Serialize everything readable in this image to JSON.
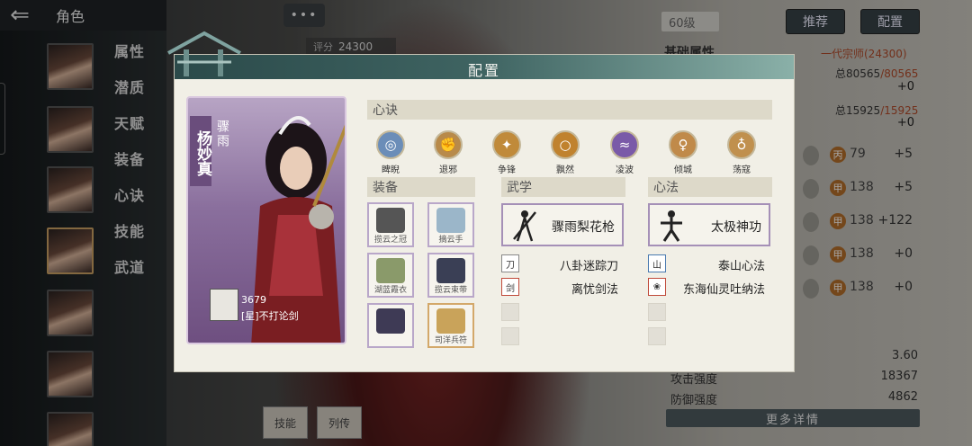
{
  "header": {
    "back_icon": "back-arrow-icon",
    "title": "角色"
  },
  "sidebar": {
    "menu": [
      "属性",
      "潜质",
      "天赋",
      "装备",
      "心诀",
      "技能",
      "武道"
    ]
  },
  "top": {
    "chat": "•••",
    "level": "60级",
    "recommend": "推荐",
    "config": "配置",
    "score_label": "评分",
    "score_value": "24300"
  },
  "right_stats": {
    "basic_title": "基础属性",
    "rank": "一代宗师(24300)",
    "hp_label": "总80565",
    "hp_max": "/80565",
    "hp_plus": "+0",
    "mp_label": "总15925",
    "mp_max": "/15925",
    "mp_plus": "+0",
    "rows": [
      {
        "grade": "丙",
        "value": "79",
        "plus": "+5"
      },
      {
        "grade": "甲",
        "value": "138",
        "plus": "+5"
      },
      {
        "grade": "甲",
        "value": "138",
        "plus": "+122"
      },
      {
        "grade": "甲",
        "value": "138",
        "plus": "+0"
      },
      {
        "grade": "甲",
        "value": "138",
        "plus": "+0"
      }
    ],
    "misc_value": "3.60",
    "attack_label": "攻击强度",
    "attack_value": "18367",
    "defense_label": "防御强度",
    "defense_value": "4862",
    "more_details": "更多详情"
  },
  "bottom_tabs": [
    "技能",
    "列传"
  ],
  "modal": {
    "title": "配置",
    "character": {
      "name": "杨妙真",
      "title": "骤雨",
      "score": "3679",
      "sect": "[星]不打论剑"
    },
    "xinjue_header": "心诀",
    "xinjue": [
      {
        "label": "睥睨",
        "icon": "swirl-icon",
        "color": "#6b8db8"
      },
      {
        "label": "退邪",
        "icon": "fist-icon",
        "color": "#b88a4a"
      },
      {
        "label": "争锋",
        "icon": "strike-icon",
        "color": "#c08a3a"
      },
      {
        "label": "飘然",
        "icon": "ring-icon",
        "color": "#c0822e"
      },
      {
        "label": "凌波",
        "icon": "wave-icon",
        "color": "#7a5aa8"
      },
      {
        "label": "倾城",
        "icon": "figure-icon",
        "color": "#c08a4a"
      },
      {
        "label": "荡寇",
        "icon": "bell-icon",
        "color": "#c0904e"
      }
    ],
    "equip_header": "装备",
    "equipment": [
      {
        "label": "揽云之冠"
      },
      {
        "label": "摘云手"
      },
      {
        "label": "湖蓝霞衣"
      },
      {
        "label": "揽云束带"
      },
      {
        "label": ""
      },
      {
        "label": "司洋兵符"
      }
    ],
    "wuxue_header": "武学",
    "wuxue_main": "骤雨梨花枪",
    "wuxue_list": [
      "八卦迷踪刀",
      "离忧剑法"
    ],
    "xinfa_header": "心法",
    "xinfa_main": "太极神功",
    "xinfa_list": [
      "泰山心法",
      "东海仙灵吐纳法"
    ]
  }
}
